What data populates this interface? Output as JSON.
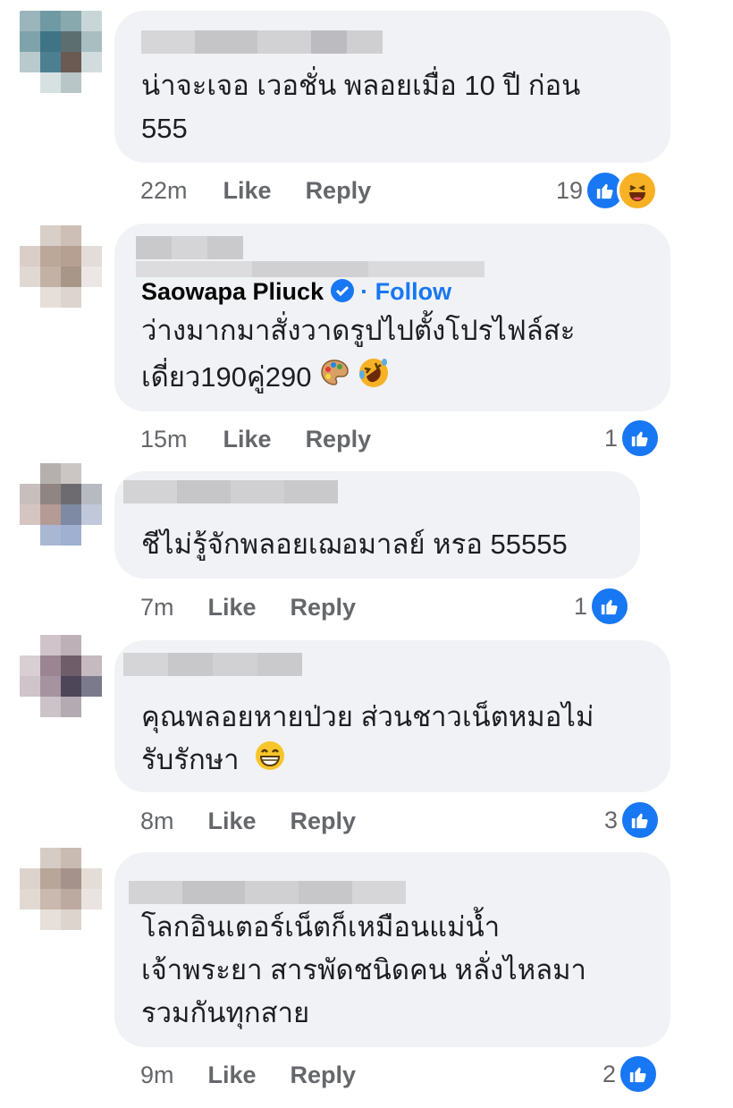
{
  "comments": [
    {
      "lines": [
        "น่าจะเจอ เวอชั่น พลอยเมื่อ 10 ปี ก่อน",
        "555"
      ],
      "time": "22m",
      "like": "Like",
      "reply": "Reply",
      "count": "19",
      "reactions": [
        "like-icon",
        "haha-icon"
      ]
    },
    {
      "mention": "Saowapa Pliuck",
      "follow": "· Follow",
      "lines": [
        "ว่างมากมาสั่งวาดรูปไปตั้งโปรไฟล์สะ",
        "เดี่ยว190คู่290"
      ],
      "time": "15m",
      "like": "Like",
      "reply": "Reply",
      "count": "1",
      "reactions": [
        "like-icon"
      ]
    },
    {
      "lines": [
        "ชีไม่รู้จักพลอยเฌอมาลย์ หรอ 55555"
      ],
      "time": "7m",
      "like": "Like",
      "reply": "Reply",
      "count": "1",
      "reactions": [
        "like-icon"
      ]
    },
    {
      "lines": [
        "คุณพลอยหายป่วย ส่วนชาวเน็ตหมอไม่",
        "รับรักษา"
      ],
      "time": "8m",
      "like": "Like",
      "reply": "Reply",
      "count": "3",
      "reactions": [
        "like-icon"
      ]
    },
    {
      "lines": [
        "โลกอินเตอร์เน็ตก็เหมือนแม่น้ำ",
        "เจ้าพระยา สารพัดชนิดคน หลั่งไหลมา",
        "รวมกันทุกสาย"
      ],
      "time": "9m",
      "like": "Like",
      "reply": "Reply",
      "count": "2",
      "reactions": [
        "like-icon"
      ]
    }
  ],
  "colors": {
    "like_blue": "#1877f2",
    "bubble": "#f0f2f5",
    "meta_gray": "#65676b"
  }
}
